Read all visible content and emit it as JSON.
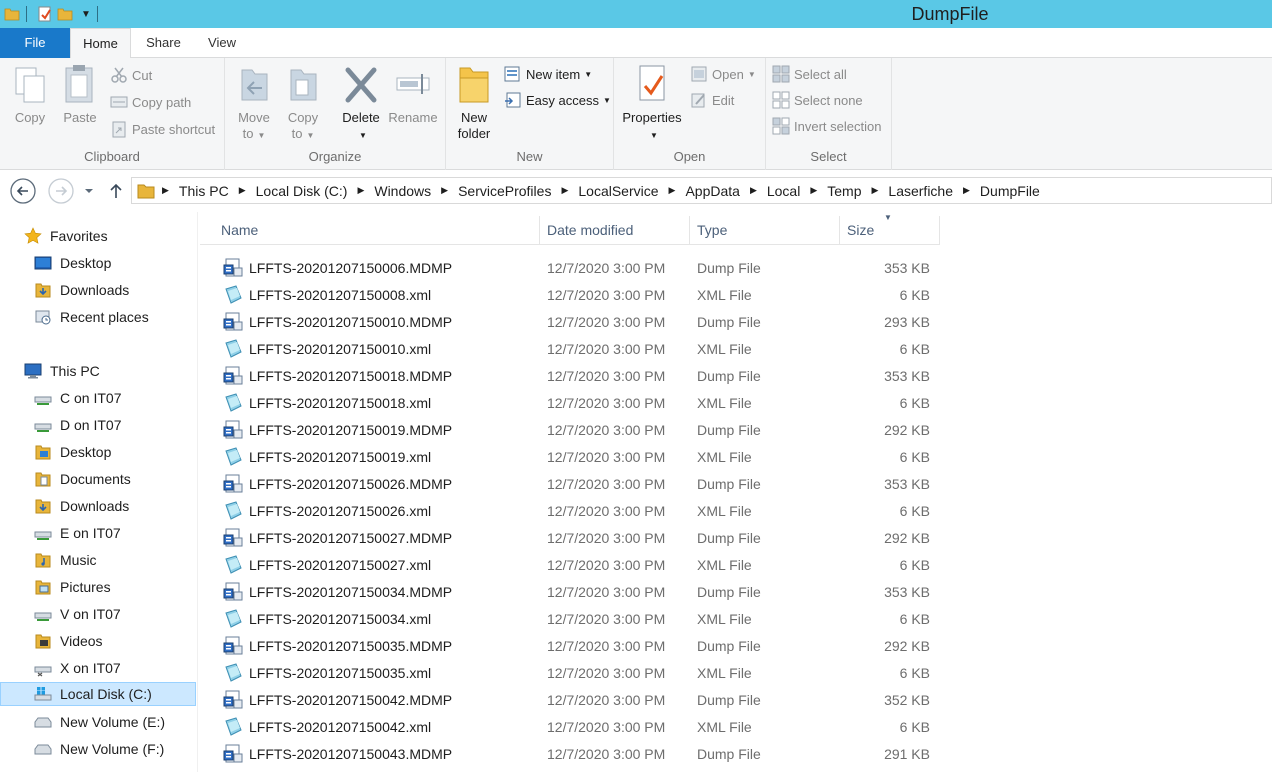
{
  "window": {
    "title": "DumpFile"
  },
  "ribbon_tabs": [
    {
      "label": "File"
    },
    {
      "label": "Home"
    },
    {
      "label": "Share"
    },
    {
      "label": "View"
    }
  ],
  "clipboard": {
    "group_label": "Clipboard",
    "copy": "Copy",
    "paste": "Paste",
    "cut": "Cut",
    "copy_path": "Copy path",
    "paste_shortcut": "Paste shortcut"
  },
  "organize": {
    "group_label": "Organize",
    "move_to": "Move",
    "move_to_2": "to",
    "copy_to": "Copy",
    "copy_to_2": "to",
    "delete": "Delete",
    "rename": "Rename"
  },
  "new": {
    "group_label": "New",
    "new_folder": "New",
    "new_folder_2": "folder",
    "new_item": "New item",
    "easy_access": "Easy access"
  },
  "open": {
    "group_label": "Open",
    "properties": "Properties",
    "open": "Open",
    "edit": "Edit"
  },
  "select": {
    "group_label": "Select",
    "select_all": "Select all",
    "select_none": "Select none",
    "invert_selection": "Invert selection"
  },
  "breadcrumb": [
    "This PC",
    "Local Disk (C:)",
    "Windows",
    "ServiceProfiles",
    "LocalService",
    "AppData",
    "Local",
    "Temp",
    "Laserfiche",
    "DumpFile"
  ],
  "nav": {
    "favorites": "Favorites",
    "fav_desktop": "Desktop",
    "fav_downloads": "Downloads",
    "fav_recent": "Recent places",
    "this_pc": "This PC",
    "c_on_it07": "C on IT07",
    "d_on_it07": "D on IT07",
    "desktop": "Desktop",
    "documents": "Documents",
    "downloads": "Downloads",
    "e_on_it07": "E on IT07",
    "music": "Music",
    "pictures": "Pictures",
    "v_on_it07": "V on IT07",
    "videos": "Videos",
    "x_on_it07": "X on IT07",
    "local_disk_c": "Local Disk (C:)",
    "new_volume_e": "New Volume (E:)",
    "new_volume_f": "New Volume (F:)"
  },
  "columns": {
    "name": "Name",
    "date": "Date modified",
    "type": "Type",
    "size": "Size"
  },
  "files": [
    {
      "name": "LFFTS-20201207150006.MDMP",
      "date": "12/7/2020 3:00 PM",
      "type": "Dump File",
      "size": "353 KB",
      "kind": "dump"
    },
    {
      "name": "LFFTS-20201207150008.xml",
      "date": "12/7/2020 3:00 PM",
      "type": "XML File",
      "size": "6 KB",
      "kind": "xml"
    },
    {
      "name": "LFFTS-20201207150010.MDMP",
      "date": "12/7/2020 3:00 PM",
      "type": "Dump File",
      "size": "293 KB",
      "kind": "dump"
    },
    {
      "name": "LFFTS-20201207150010.xml",
      "date": "12/7/2020 3:00 PM",
      "type": "XML File",
      "size": "6 KB",
      "kind": "xml"
    },
    {
      "name": "LFFTS-20201207150018.MDMP",
      "date": "12/7/2020 3:00 PM",
      "type": "Dump File",
      "size": "353 KB",
      "kind": "dump"
    },
    {
      "name": "LFFTS-20201207150018.xml",
      "date": "12/7/2020 3:00 PM",
      "type": "XML File",
      "size": "6 KB",
      "kind": "xml"
    },
    {
      "name": "LFFTS-20201207150019.MDMP",
      "date": "12/7/2020 3:00 PM",
      "type": "Dump File",
      "size": "292 KB",
      "kind": "dump"
    },
    {
      "name": "LFFTS-20201207150019.xml",
      "date": "12/7/2020 3:00 PM",
      "type": "XML File",
      "size": "6 KB",
      "kind": "xml"
    },
    {
      "name": "LFFTS-20201207150026.MDMP",
      "date": "12/7/2020 3:00 PM",
      "type": "Dump File",
      "size": "353 KB",
      "kind": "dump"
    },
    {
      "name": "LFFTS-20201207150026.xml",
      "date": "12/7/2020 3:00 PM",
      "type": "XML File",
      "size": "6 KB",
      "kind": "xml"
    },
    {
      "name": "LFFTS-20201207150027.MDMP",
      "date": "12/7/2020 3:00 PM",
      "type": "Dump File",
      "size": "292 KB",
      "kind": "dump"
    },
    {
      "name": "LFFTS-20201207150027.xml",
      "date": "12/7/2020 3:00 PM",
      "type": "XML File",
      "size": "6 KB",
      "kind": "xml"
    },
    {
      "name": "LFFTS-20201207150034.MDMP",
      "date": "12/7/2020 3:00 PM",
      "type": "Dump File",
      "size": "353 KB",
      "kind": "dump"
    },
    {
      "name": "LFFTS-20201207150034.xml",
      "date": "12/7/2020 3:00 PM",
      "type": "XML File",
      "size": "6 KB",
      "kind": "xml"
    },
    {
      "name": "LFFTS-20201207150035.MDMP",
      "date": "12/7/2020 3:00 PM",
      "type": "Dump File",
      "size": "292 KB",
      "kind": "dump"
    },
    {
      "name": "LFFTS-20201207150035.xml",
      "date": "12/7/2020 3:00 PM",
      "type": "XML File",
      "size": "6 KB",
      "kind": "xml"
    },
    {
      "name": "LFFTS-20201207150042.MDMP",
      "date": "12/7/2020 3:00 PM",
      "type": "Dump File",
      "size": "352 KB",
      "kind": "dump"
    },
    {
      "name": "LFFTS-20201207150042.xml",
      "date": "12/7/2020 3:00 PM",
      "type": "XML File",
      "size": "6 KB",
      "kind": "xml"
    },
    {
      "name": "LFFTS-20201207150043.MDMP",
      "date": "12/7/2020 3:00 PM",
      "type": "Dump File",
      "size": "291 KB",
      "kind": "dump"
    }
  ],
  "colors": {
    "titlebar": "#5ac8e6",
    "file_tab": "#1979ca",
    "selected_nav": "#cce8ff",
    "ribbon_bg": "#f5f6f7"
  }
}
